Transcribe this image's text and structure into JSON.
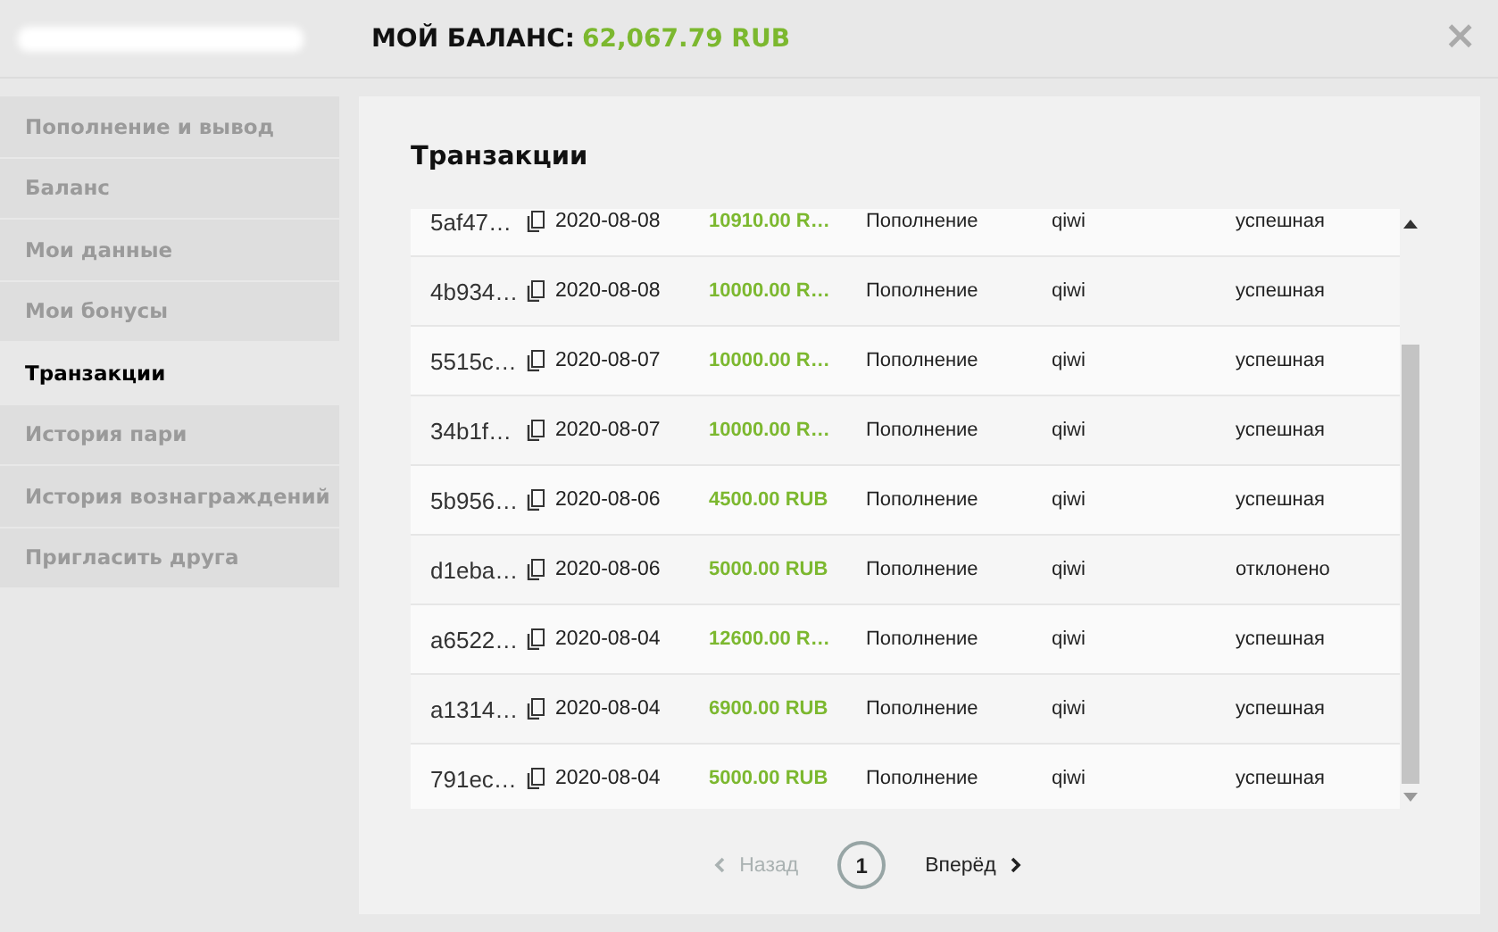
{
  "header": {
    "balance_label": "МОЙ БАЛАНС:",
    "balance_value": "62,067.79 RUB",
    "close": "×"
  },
  "sidebar": {
    "items": [
      {
        "label": "Пополнение и вывод",
        "selected": false
      },
      {
        "label": "Баланс",
        "selected": false
      },
      {
        "label": "Мои данные",
        "selected": false
      },
      {
        "label": "Мои бонусы",
        "selected": false
      },
      {
        "label": "Транзакции",
        "selected": true
      },
      {
        "label": "История пари",
        "selected": false
      },
      {
        "label": "История вознаграждений",
        "selected": false
      },
      {
        "label": "Пригласить друга",
        "selected": false
      }
    ]
  },
  "panel": {
    "title": "Транзакции",
    "table": {
      "rows": [
        {
          "id": "5af47…",
          "date": "2020-08-08",
          "amount": "10910.00 R…",
          "type": "Пополнение",
          "method": "qiwi",
          "status": "успешная"
        },
        {
          "id": "4b934…",
          "date": "2020-08-08",
          "amount": "10000.00 R…",
          "type": "Пополнение",
          "method": "qiwi",
          "status": "успешная"
        },
        {
          "id": "5515c…",
          "date": "2020-08-07",
          "amount": "10000.00 R…",
          "type": "Пополнение",
          "method": "qiwi",
          "status": "успешная"
        },
        {
          "id": "34b1f…",
          "date": "2020-08-07",
          "amount": "10000.00 R…",
          "type": "Пополнение",
          "method": "qiwi",
          "status": "успешная"
        },
        {
          "id": "5b956…",
          "date": "2020-08-06",
          "amount": "4500.00 RUB",
          "type": "Пополнение",
          "method": "qiwi",
          "status": "успешная"
        },
        {
          "id": "d1eba…",
          "date": "2020-08-06",
          "amount": "5000.00 RUB",
          "type": "Пополнение",
          "method": "qiwi",
          "status": "отклонено"
        },
        {
          "id": "a6522…",
          "date": "2020-08-04",
          "amount": "12600.00 R…",
          "type": "Пополнение",
          "method": "qiwi",
          "status": "успешная"
        },
        {
          "id": "a1314…",
          "date": "2020-08-04",
          "amount": "6900.00 RUB",
          "type": "Пополнение",
          "method": "qiwi",
          "status": "успешная"
        },
        {
          "id": "791ec…",
          "date": "2020-08-04",
          "amount": "5000.00 RUB",
          "type": "Пополнение",
          "method": "qiwi",
          "status": "успешная"
        }
      ]
    },
    "pagination": {
      "prev": {
        "label": "Назад",
        "disabled": true
      },
      "pages": [
        {
          "label": "1",
          "selected": true
        }
      ],
      "next": {
        "label": "Вперёд",
        "disabled": false
      }
    }
  }
}
